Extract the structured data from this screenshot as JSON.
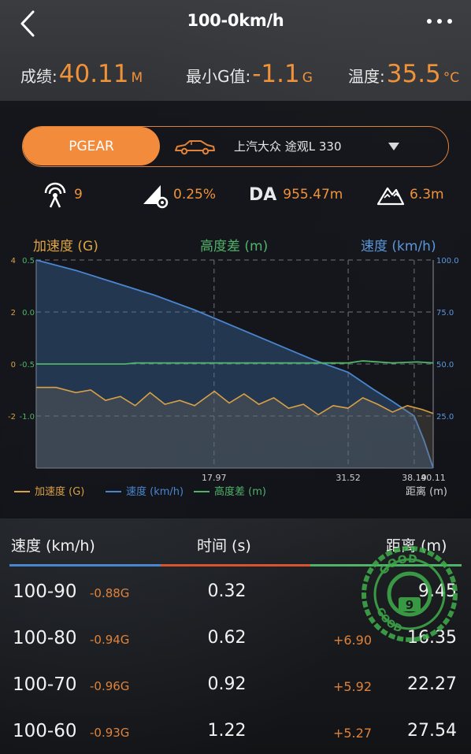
{
  "header": {
    "title": "100-0km/h"
  },
  "stats": {
    "result_label": "成绩:",
    "result_value": "40.11",
    "result_unit": "M",
    "min_g_label": "最小G值:",
    "min_g_value": "-1.1",
    "min_g_unit": "G",
    "temp_label": "温度:",
    "temp_value": "35.5",
    "temp_unit": "°C"
  },
  "selector": {
    "device": "PGEAR",
    "car": "上汽大众  途观L  330"
  },
  "metrics": {
    "satellites": "9",
    "slope": "0.25%",
    "da_label": "DA",
    "da_value": "955.47m",
    "altitude": "6.3m"
  },
  "colors": {
    "accent": "#f0923a",
    "accel": "#d9a045",
    "speed": "#4a86d0",
    "height": "#4fb36a"
  },
  "chart_data": {
    "type": "line",
    "titles": {
      "left": "加速度 (G)",
      "center": "高度差 (m)",
      "right": "速度 (km/h)"
    },
    "left_axis_ticks": [
      "4",
      "2",
      "0",
      "-2"
    ],
    "height_axis_ticks": [
      "0.5",
      "0.0",
      "-0.5",
      "-1.0"
    ],
    "right_axis_ticks": [
      "100.0",
      "75.0",
      "50.0",
      "25.0"
    ],
    "x_ticks": [
      "17.97",
      "31.52",
      "38.19",
      "40.11"
    ],
    "xlabel": "距离 (m)",
    "ylim_accel": [
      -4,
      4
    ],
    "ylim_speed": [
      0,
      100
    ],
    "ylim_height": [
      -1.5,
      0.5
    ],
    "x_range": [
      0,
      40.11
    ],
    "legend": [
      "加速度 (G)",
      "速度 (km/h)",
      "高度差 (m)"
    ],
    "series": [
      {
        "name": "速度 (km/h)",
        "x": [
          0,
          4,
          8,
          12,
          16,
          20,
          24,
          28,
          31.52,
          34,
          36,
          38.19,
          39.2,
          40.11
        ],
        "values": [
          100,
          95,
          89,
          83,
          76,
          68,
          60,
          52,
          46,
          38,
          32,
          25,
          13,
          0
        ]
      },
      {
        "name": "加速度 (G)",
        "x": [
          0,
          2,
          4,
          5.5,
          7,
          8.5,
          10,
          11.5,
          13,
          14.5,
          16,
          18,
          19.5,
          21,
          22.5,
          24,
          25.5,
          27,
          28.5,
          30,
          31.5,
          33,
          34.5,
          36,
          37.5,
          39,
          40.11
        ],
        "values": [
          -0.9,
          -0.9,
          -1.1,
          -1.0,
          -1.4,
          -1.25,
          -1.6,
          -1.1,
          -1.55,
          -1.4,
          -1.6,
          -1.05,
          -1.5,
          -1.15,
          -1.55,
          -1.3,
          -1.7,
          -1.55,
          -1.95,
          -1.6,
          -1.7,
          -1.3,
          -1.55,
          -1.85,
          -1.6,
          -1.75,
          -1.9
        ]
      },
      {
        "name": "高度差 (m)",
        "x": [
          0,
          5,
          9,
          10,
          15,
          20,
          25,
          31.52,
          33,
          36,
          38.5,
          40.11
        ],
        "values": [
          -0.5,
          -0.5,
          -0.5,
          -0.49,
          -0.49,
          -0.49,
          -0.49,
          -0.49,
          -0.47,
          -0.49,
          -0.48,
          -0.49
        ]
      }
    ],
    "grid": true
  },
  "table": {
    "headers": {
      "speed": "速度 (km/h)",
      "time": "时间 (s)",
      "distance": "距离 (m)"
    },
    "rows": [
      {
        "range": "100-90",
        "g": "-0.88G",
        "time": "0.32",
        "delta": "",
        "distance": "9.45"
      },
      {
        "range": "100-80",
        "g": "-0.94G",
        "time": "0.62",
        "delta": "+6.90",
        "distance": "16.35"
      },
      {
        "range": "100-70",
        "g": "-0.96G",
        "time": "0.92",
        "delta": "+5.92",
        "distance": "22.27"
      },
      {
        "range": "100-60",
        "g": "-0.93G",
        "time": "1.22",
        "delta": "+5.27",
        "distance": "27.54"
      }
    ]
  },
  "stamp": {
    "text_top": "GOOD",
    "text_inner": "GOOD",
    "number": "9"
  }
}
